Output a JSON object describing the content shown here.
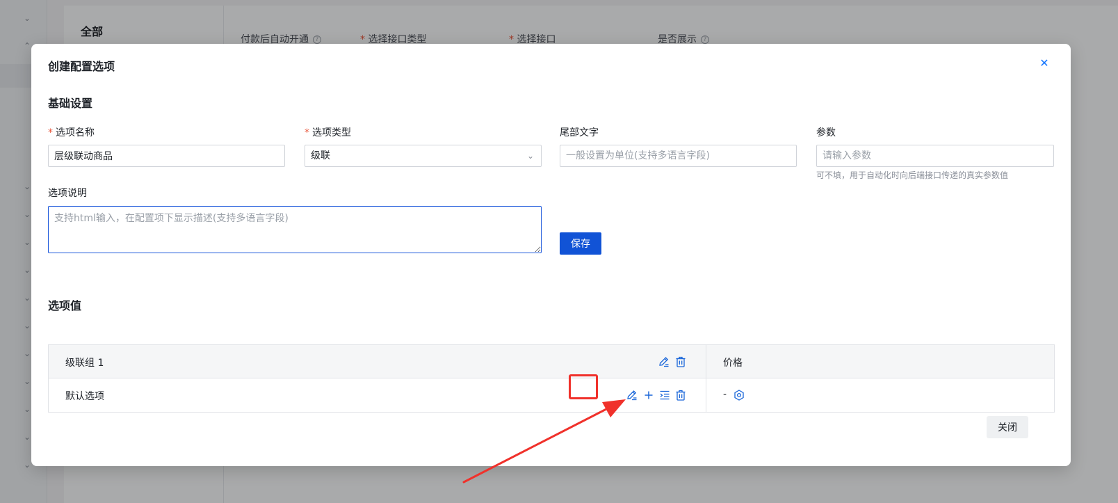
{
  "background": {
    "panel_title": "全部",
    "labels": [
      {
        "text": "付款后自动开通",
        "required": false,
        "help": true
      },
      {
        "text": "选择接口类型",
        "required": true,
        "help": false
      },
      {
        "text": "选择接口",
        "required": true,
        "help": false
      },
      {
        "text": "是否展示",
        "required": false,
        "help": true
      }
    ]
  },
  "modal": {
    "title": "创建配置选项",
    "close_icon": "close-icon",
    "basic_section": "基础设置",
    "fields": {
      "option_name": {
        "label": "选项名称",
        "value": "层级联动商品"
      },
      "option_type": {
        "label": "选项类型",
        "value": "级联"
      },
      "suffix_text": {
        "label": "尾部文字",
        "placeholder": "一般设置为单位(支持多语言字段)"
      },
      "param": {
        "label": "参数",
        "placeholder": "请输入参数",
        "hint": "可不填，用于自动化时向后端接口传递的真实参数值"
      },
      "description": {
        "label": "选项说明",
        "placeholder": "支持html输入，在配置项下显示描述(支持多语言字段)"
      }
    },
    "save_label": "保存",
    "values_section": "选项值",
    "table": {
      "group_header": "级联组 1",
      "price_header": "价格",
      "row_label": "默认选项",
      "row_price": "-"
    },
    "close_label": "关闭"
  },
  "colors": {
    "primary": "#1153d6",
    "icon": "#1a66d9",
    "required": "#e8553a",
    "annotation": "#f0312b"
  }
}
